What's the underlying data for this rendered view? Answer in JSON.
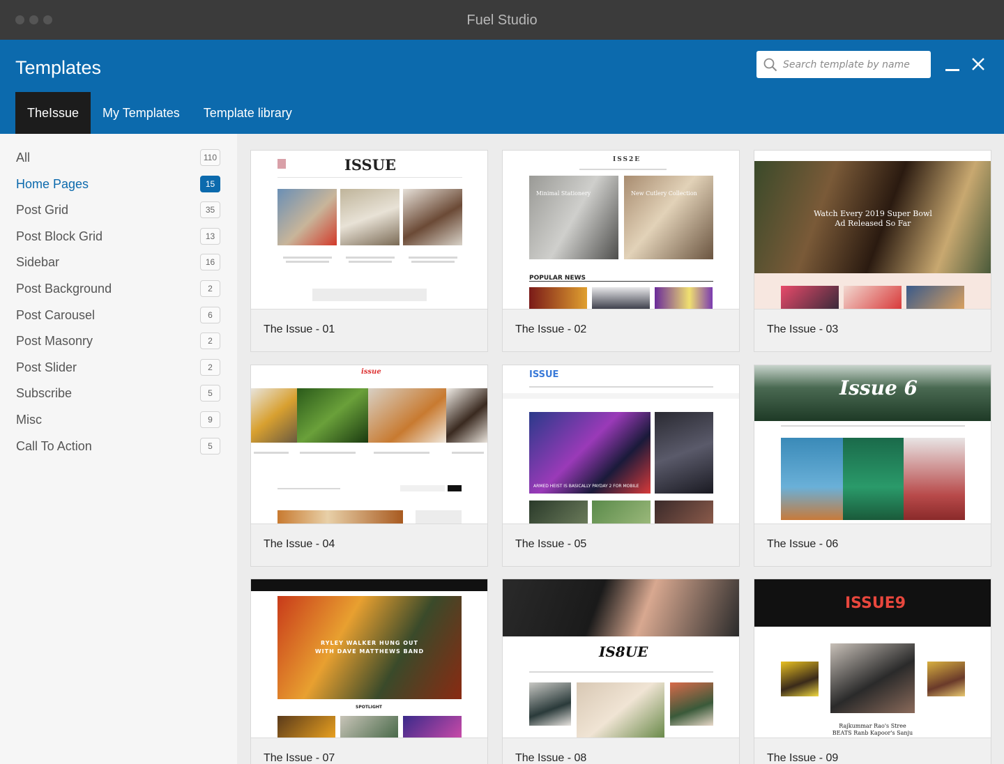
{
  "window": {
    "title": "Fuel Studio"
  },
  "header": {
    "title": "Templates",
    "search_placeholder": "Search template by name",
    "tabs": [
      {
        "label": "TheIssue",
        "active": true
      },
      {
        "label": "My Templates",
        "active": false
      },
      {
        "label": "Template library",
        "active": false
      }
    ]
  },
  "sidebar": {
    "categories": [
      {
        "label": "All",
        "count": "110"
      },
      {
        "label": "Home Pages",
        "count": "15",
        "active": true
      },
      {
        "label": "Post Grid",
        "count": "35"
      },
      {
        "label": "Post Block Grid",
        "count": "13"
      },
      {
        "label": "Sidebar",
        "count": "16"
      },
      {
        "label": "Post Background",
        "count": "2"
      },
      {
        "label": "Post Carousel",
        "count": "6"
      },
      {
        "label": "Post Masonry",
        "count": "2"
      },
      {
        "label": "Post Slider",
        "count": "2"
      },
      {
        "label": "Subscribe",
        "count": "5"
      },
      {
        "label": "Misc",
        "count": "9"
      },
      {
        "label": "Call To Action",
        "count": "5"
      }
    ]
  },
  "templates": [
    {
      "name": "The Issue - 01",
      "logo": "ISSUE"
    },
    {
      "name": "The Issue - 02",
      "logo": "ISS2E",
      "caption_a": "Minimal Stationery",
      "caption_b": "New Cutlery Collection",
      "section": "POPULAR NEWS"
    },
    {
      "name": "The Issue - 03",
      "headline": "Watch Every 2019 Super Bowl Ad Released So Far"
    },
    {
      "name": "The Issue - 04",
      "logo": "issue"
    },
    {
      "name": "The Issue - 05",
      "logo": "ISSUE",
      "caption_a": "ARMED HEIST IS BASICALLY PAYDAY 2 FOR MOBILE"
    },
    {
      "name": "The Issue - 06",
      "logo": "Issue 6"
    },
    {
      "name": "The Issue - 07",
      "headline": "RYLEY WALKER HUNG OUT WITH DAVE MATTHEWS BAND",
      "section": "SPOTLIGHT"
    },
    {
      "name": "The Issue - 08",
      "logo": "IS8UE"
    },
    {
      "name": "The Issue - 09",
      "logo": "ISSUE9",
      "caption_a": "Rajkummar Rao's Stree BEATS Ranb Kapoor's Sanju"
    }
  ],
  "colors": {
    "accent": "#0c6aad",
    "titlebar": "#3b3b3b",
    "active_tab": "#1c1c1c"
  }
}
